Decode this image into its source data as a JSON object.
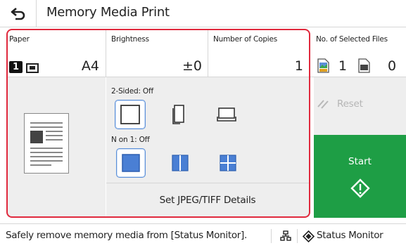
{
  "header": {
    "title": "Memory Media Print",
    "back_icon": "back-arrow-icon"
  },
  "paper": {
    "label": "Paper",
    "tray_number": "1",
    "size": "A4"
  },
  "brightness": {
    "label": "Brightness",
    "value": "±0"
  },
  "copies": {
    "label": "Number of Copies",
    "value": "1"
  },
  "selected_files": {
    "label": "No. of Selected Files",
    "jpeg_count": "1",
    "pdf_count": "0"
  },
  "two_sided": {
    "label": "2-Sided: Off",
    "options": [
      "off",
      "long-edge",
      "short-edge"
    ],
    "selected": "off"
  },
  "n_on_1": {
    "label": "N on 1: Off",
    "options": [
      "off",
      "2-on-1",
      "4-on-1"
    ],
    "selected": "off"
  },
  "details_button": "Set JPEG/TIFF Details",
  "reset_button": "Reset",
  "start_button": "Start",
  "status_bar": {
    "message": "Safely remove memory media from [Status Monitor].",
    "status_monitor": "Status Monitor"
  },
  "colors": {
    "start_green": "#1e9e45",
    "highlight_red": "#e0293d",
    "select_blue": "#5b8fd8",
    "panel_grey": "#eeeeee"
  }
}
